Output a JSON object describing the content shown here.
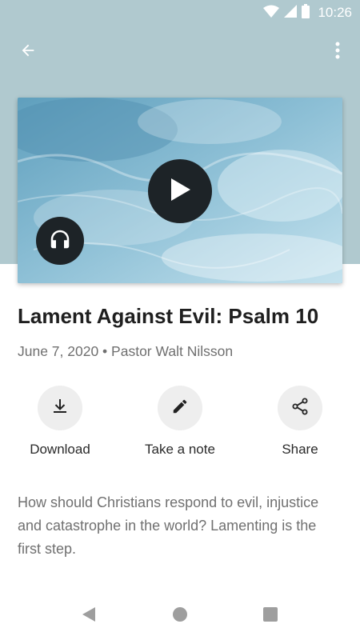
{
  "status_bar": {
    "time": "10:26"
  },
  "sermon": {
    "title": "Lament Against Evil: Psalm 10",
    "meta": "June 7, 2020 • Pastor Walt Nilsson",
    "description": "How should Christians respond to evil, injustice and catastrophe in the world? Lamenting is the first step."
  },
  "actions": {
    "download_label": "Download",
    "note_label": "Take a note",
    "share_label": "Share"
  },
  "icons": {
    "back": "arrow-back",
    "more": "more-vert",
    "play": "play",
    "audio": "headphones",
    "download": "download",
    "note": "pencil",
    "share": "share"
  },
  "colors": {
    "header_background": "#b0c9cf",
    "play_button": "#1d2327",
    "action_circle": "#eeeeee"
  }
}
